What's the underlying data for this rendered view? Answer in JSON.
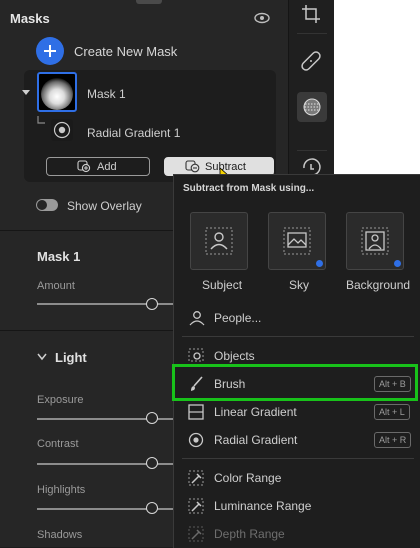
{
  "masks_panel": {
    "title": "Masks",
    "create_new_mask": "Create New Mask",
    "mask_name": "Mask 1",
    "component_name": "Radial Gradient 1",
    "add_label": "Add",
    "subtract_label": "Subtract",
    "show_overlay_label": "Show Overlay",
    "show_overlay_on": true
  },
  "mask_section": {
    "title": "Mask 1",
    "amount_label": "Amount",
    "amount_level": 0.0
  },
  "light_section": {
    "title": "Light",
    "sliders": [
      {
        "label": "Exposure",
        "level": 0.0
      },
      {
        "label": "Contrast",
        "level": 0.0
      },
      {
        "label": "Highlights",
        "level": 0.0
      },
      {
        "label": "Shadows",
        "level": 0.0
      }
    ]
  },
  "subtract_menu": {
    "header": "Subtract from Mask using...",
    "tiles": [
      {
        "label": "Subject",
        "icon": "subject-icon",
        "badge": false
      },
      {
        "label": "Sky",
        "icon": "sky-icon",
        "badge": true
      },
      {
        "label": "Background",
        "icon": "background-icon",
        "badge": true
      }
    ],
    "items": [
      {
        "label": "People...",
        "icon": "people-icon",
        "shortcut": "",
        "enabled": true
      },
      {
        "label": "Objects",
        "icon": "objects-icon",
        "shortcut": "",
        "enabled": true
      },
      {
        "label": "Brush",
        "icon": "brush-icon",
        "shortcut": "Alt + B",
        "enabled": true
      },
      {
        "label": "Linear Gradient",
        "icon": "linear-gradient-icon",
        "shortcut": "Alt + L",
        "enabled": true
      },
      {
        "label": "Radial Gradient",
        "icon": "radial-gradient-icon",
        "shortcut": "Alt + R",
        "enabled": true
      },
      {
        "label": "Color Range",
        "icon": "color-range-icon",
        "shortcut": "",
        "enabled": true
      },
      {
        "label": "Luminance Range",
        "icon": "luminance-range-icon",
        "shortcut": "",
        "enabled": true
      },
      {
        "label": "Depth Range",
        "icon": "depth-range-icon",
        "shortcut": "",
        "enabled": false
      }
    ]
  },
  "colors": {
    "accent": "#2f6fe6",
    "highlight": "#18c21a"
  }
}
